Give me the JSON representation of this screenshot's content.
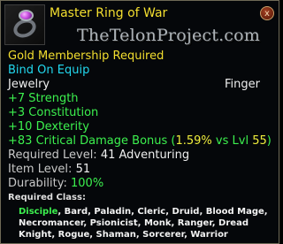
{
  "tooltip": {
    "title": "Master Ring of War",
    "close_icon": "x-icon",
    "close_label": "x",
    "watermark": "TheTelonProject.com",
    "lines": {
      "membership": "Gold Membership Required",
      "bind": "Bind On Equip",
      "type_left": "Jewelry",
      "type_right": "Finger",
      "strength": "+7 Strength",
      "constitution": "+3 Constitution",
      "dexterity": "+10 Dexterity",
      "critical_prefix": "+83 Critical Damage Bonus (",
      "critical_percent": "1.59%",
      "critical_middle": " vs Lvl ",
      "critical_level": "55",
      "critical_suffix": ")",
      "required_level_label": "Required Level: ",
      "required_level_value": "41 Adventuring",
      "item_level_label": "Item Level: ",
      "item_level_value": "51",
      "durability_label": "Durability: ",
      "durability_value": "100%",
      "required_class_title": "Required Class:",
      "class_highlight": "Disciple",
      "class_rest": ", Bard, Paladin, Cleric, Druid, Blood Mage, Necromancer, Psionicist, Monk, Ranger, Dread Knight, Rogue, Shaman, Sorcerer, Warrior"
    }
  },
  "colors": {
    "title": "#f4df2f",
    "membership": "#f4df2f",
    "bind": "#22d8ef",
    "stat": "#3cf04e",
    "highlight": "#f0ee3c",
    "body_text": "#efefef",
    "label_text": "#c8c8c8"
  },
  "icons": {
    "item": "ring-icon",
    "close": "close-icon"
  }
}
